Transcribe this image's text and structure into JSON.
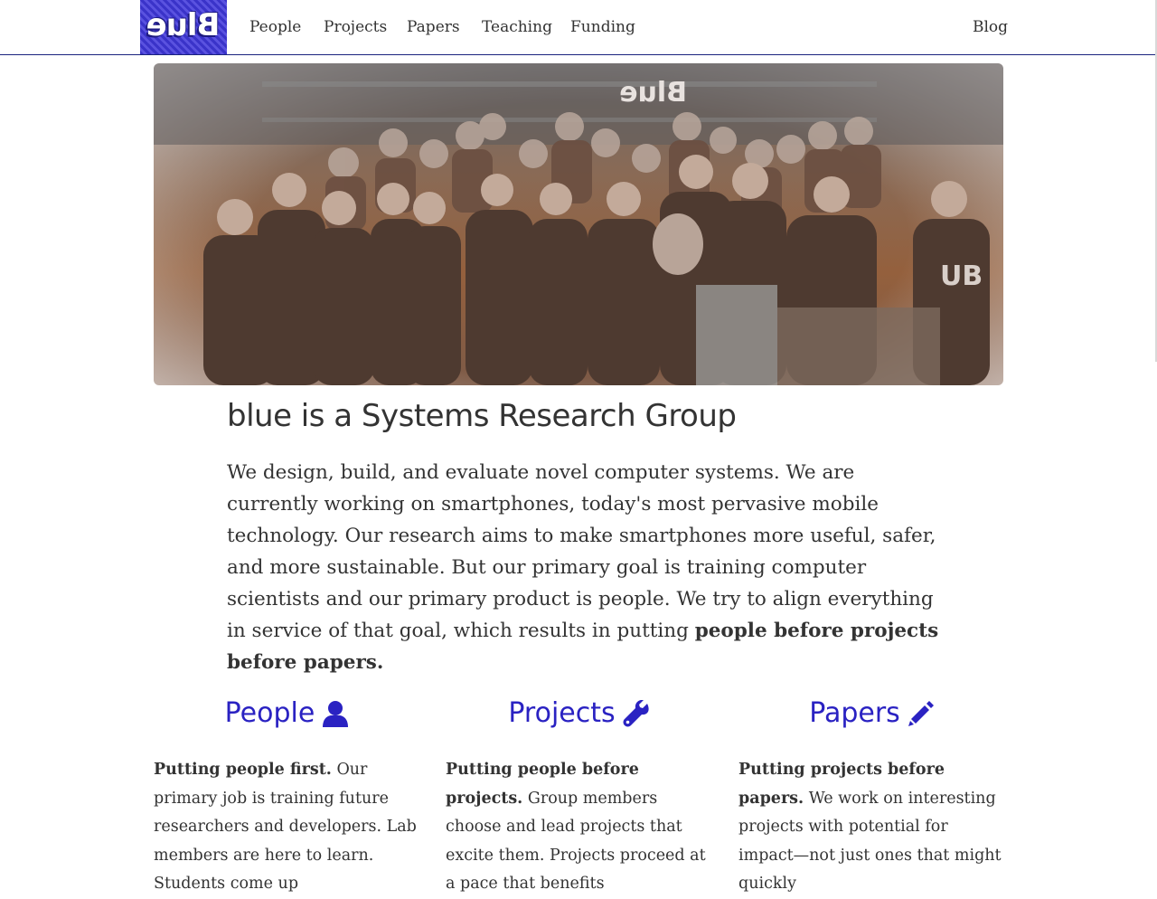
{
  "nav": {
    "logo_text": "Blue",
    "links": [
      "People",
      "Projects",
      "Papers",
      "Teaching",
      "Funding"
    ],
    "blog": "Blog"
  },
  "hero": {
    "image": "group-photo",
    "sign_text": "Blue"
  },
  "headline": "blue is a Systems Research Group",
  "intro": {
    "text": "We design, build, and evaluate novel computer systems. We are currently working on smartphones, today's most pervasive mobile technology. Our research aims to make smartphones more useful, safer, and more sustainable. But our primary goal is training computer scientists and our primary product is people. We try to align everything in service of that goal, which results in putting ",
    "emphasis": "people before projects before papers."
  },
  "columns": [
    {
      "title": "People",
      "icon": "user-icon",
      "lead": "Putting people first.",
      "body": " Our primary job is training future researchers and developers. Lab members are here to learn. Students come up"
    },
    {
      "title": "Projects",
      "icon": "wrench-icon",
      "lead": "Putting people before projects.",
      "body": " Group members choose and lead projects that excite them. Projects proceed at a pace that benefits"
    },
    {
      "title": "Papers",
      "icon": "pencil-icon",
      "lead": "Putting projects before papers.",
      "body": " We work on interesting projects with potential for impact—not just ones that might quickly"
    }
  ],
  "colors": {
    "link_blue": "#2a22c2",
    "nav_border": "#1a237e",
    "text": "#333333"
  }
}
